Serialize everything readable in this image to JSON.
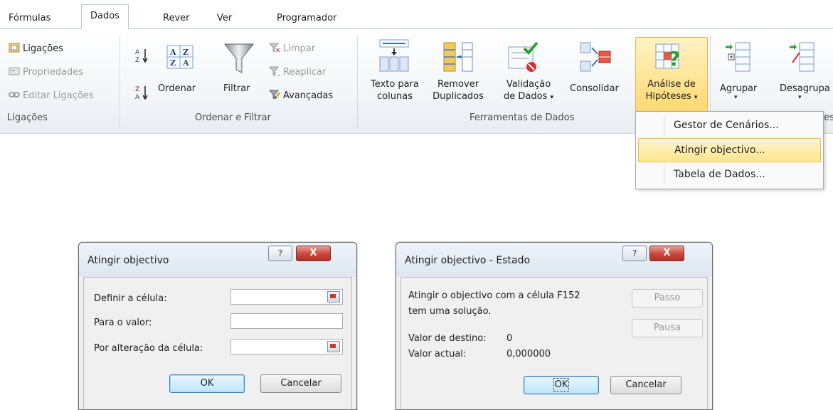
{
  "tabs": [
    "Fórmulas",
    "Dados",
    "Rever",
    "Ver",
    "Programador"
  ],
  "groups": {
    "ligacoes": {
      "label": "Ligações",
      "items": [
        "Ligações",
        "Propriedades",
        "Editar Ligações"
      ]
    },
    "ordenar": {
      "label": "Ordenar e Filtrar",
      "ordenar": "Ordenar",
      "filtrar": "Filtrar",
      "limpar": "Limpar",
      "reaplicar": "Reaplicar",
      "avancadas": "Avançadas"
    },
    "ferramentas": {
      "label": "Ferramentas de Dados",
      "texto_l1": "Texto para",
      "texto_l2": "colunas",
      "remover_l1": "Remover",
      "remover_l2": "Duplicados",
      "validacao_l1": "Validação",
      "validacao_l2": "de Dados",
      "consolidar": "Consolidar",
      "analise_l1": "Análise de",
      "analise_l2": "Hipóteses"
    },
    "destaques": {
      "label_fragment": "ues",
      "agrupar": "Agrupar",
      "desagrupar": "Desagrupa"
    }
  },
  "menu": {
    "items": [
      "Gestor de Cenários...",
      "Atingir objectivo...",
      "Tabela de Dados..."
    ]
  },
  "dialog1": {
    "title": "Atingir objectivo",
    "help": "?",
    "close": "X",
    "label_definir": "Definir a célula:",
    "label_valor": "Para o valor:",
    "label_alteracao": "Por alteração da célula:",
    "definir_value": "",
    "valor_value": "",
    "alteracao_value": "",
    "ok": "OK",
    "cancel": "Cancelar"
  },
  "dialog2": {
    "title": "Atingir objectivo - Estado",
    "help": "?",
    "close": "X",
    "msg_l1": "Atingir o objectivo com a célula F152",
    "msg_l2": "tem uma solução.",
    "destino_label": "Valor de destino:",
    "destino_value": "0",
    "actual_label": "Valor actual:",
    "actual_value": "0,000000",
    "passo": "Passo",
    "pausa": "Pausa",
    "ok": "OK",
    "cancel": "Cancelar"
  }
}
